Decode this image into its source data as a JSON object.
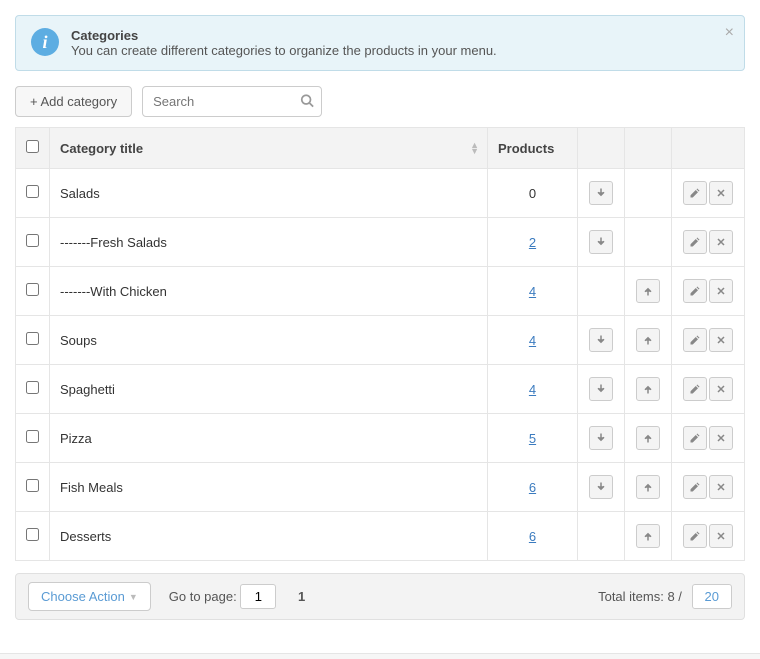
{
  "banner": {
    "title": "Categories",
    "text": "You can create different categories to organize the products in your menu."
  },
  "toolbar": {
    "add_category": "+ Add category",
    "search_placeholder": "Search"
  },
  "table": {
    "headers": {
      "title": "Category title",
      "products": "Products"
    },
    "rows": [
      {
        "title": "Salads",
        "products": "0",
        "is_link": false,
        "down": true,
        "up": false
      },
      {
        "title": "-------Fresh Salads",
        "products": "2",
        "is_link": true,
        "down": true,
        "up": false
      },
      {
        "title": "-------With Chicken",
        "products": "4",
        "is_link": true,
        "down": false,
        "up": true
      },
      {
        "title": "Soups",
        "products": "4",
        "is_link": true,
        "down": true,
        "up": true
      },
      {
        "title": "Spaghetti",
        "products": "4",
        "is_link": true,
        "down": true,
        "up": true
      },
      {
        "title": "Pizza",
        "products": "5",
        "is_link": true,
        "down": true,
        "up": true
      },
      {
        "title": "Fish Meals",
        "products": "6",
        "is_link": true,
        "down": true,
        "up": true
      },
      {
        "title": "Desserts",
        "products": "6",
        "is_link": true,
        "down": false,
        "up": true
      }
    ]
  },
  "footer": {
    "choose_action": "Choose Action",
    "goto_label": "Go to page:",
    "goto_value": "1",
    "current_page": "1",
    "total_label": "Total items: 8 /",
    "per_page": "20"
  }
}
